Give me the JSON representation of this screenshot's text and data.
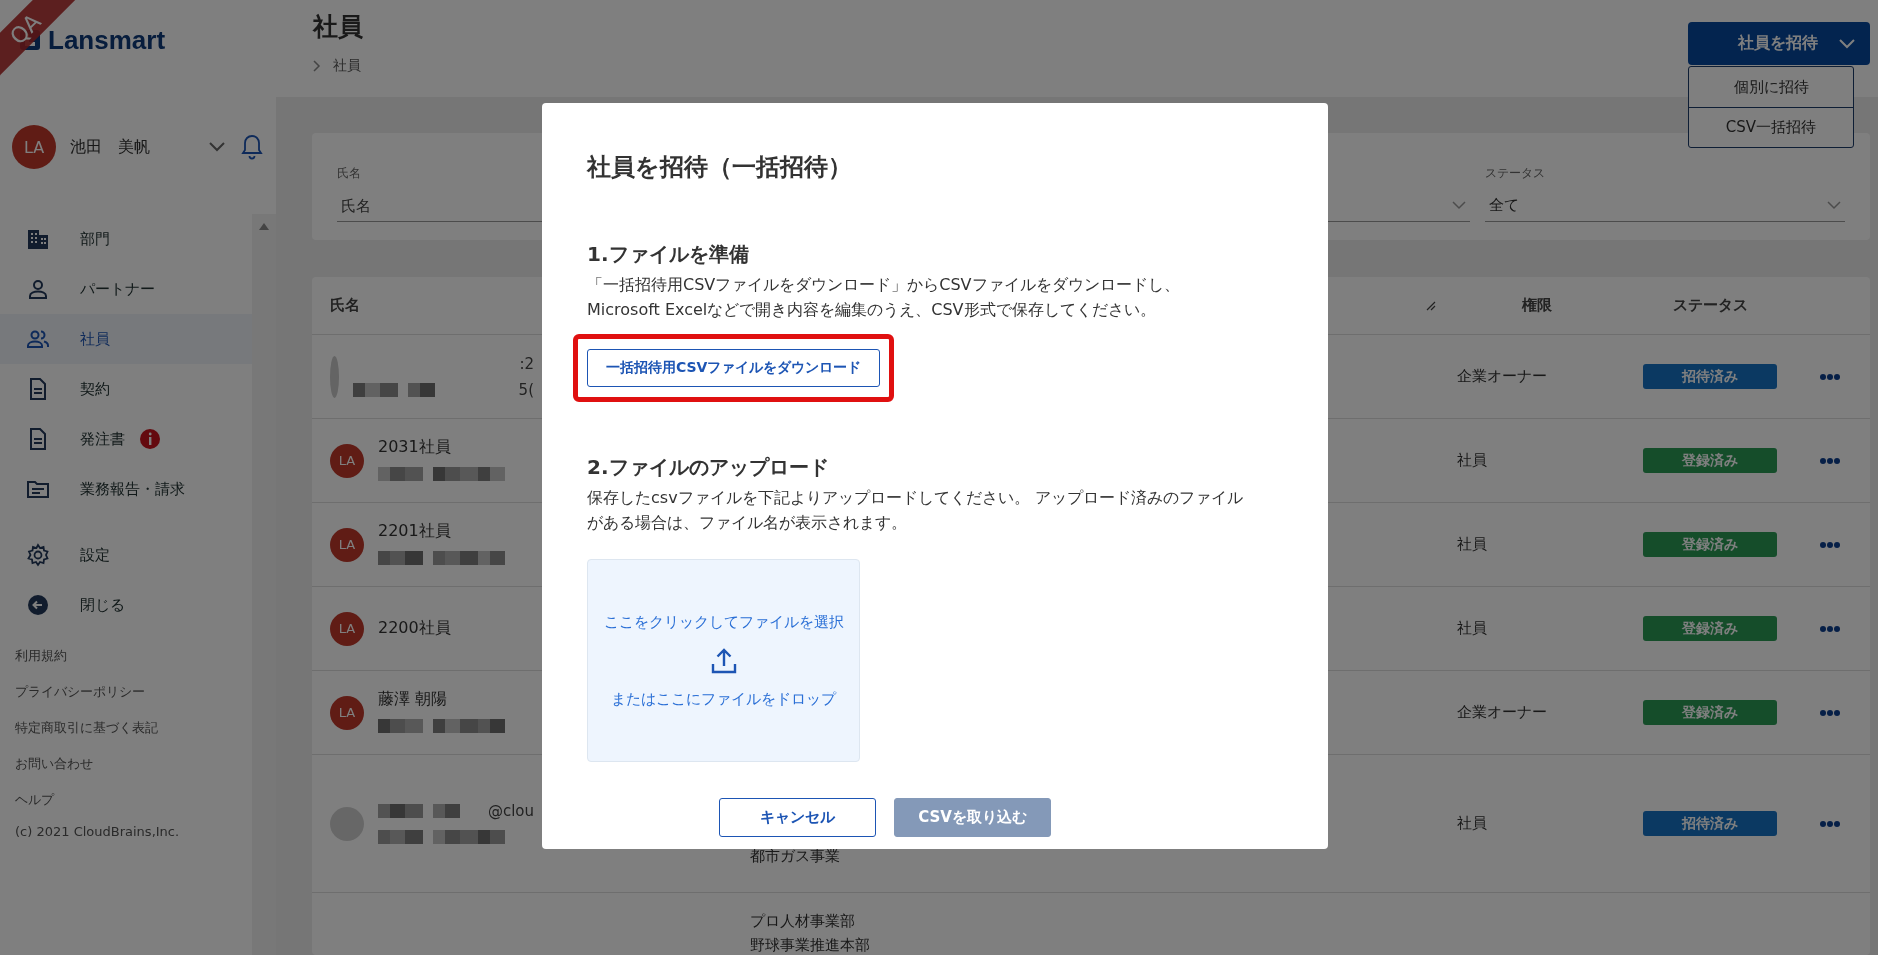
{
  "app": {
    "logo": "Lansmart",
    "ribbon": "QA"
  },
  "user": {
    "initials": "LA",
    "name": "池田　美帆"
  },
  "nav": [
    {
      "label": "部門",
      "selected": false,
      "alert": false
    },
    {
      "label": "パートナー",
      "selected": false,
      "alert": false
    },
    {
      "label": "社員",
      "selected": true,
      "alert": false
    },
    {
      "label": "契約",
      "selected": false,
      "alert": false
    },
    {
      "label": "発注書",
      "selected": false,
      "alert": true
    },
    {
      "label": "業務報告・請求",
      "selected": false,
      "alert": false
    }
  ],
  "nav_bottom": [
    {
      "label": "設定"
    },
    {
      "label": "閉じる"
    }
  ],
  "footer_links": [
    "利用規約",
    "プライバシーポリシー",
    "特定商取引に基づく表記",
    "お問い合わせ",
    "ヘルプ"
  ],
  "copyright": "(c) 2021 CloudBrains,Inc.",
  "page": {
    "title": "社員",
    "breadcrumb": "社員"
  },
  "invite_button": {
    "label": "社員を招待",
    "expanded": true,
    "menu": [
      "個別に招待",
      "CSV一括招待"
    ]
  },
  "filters": [
    {
      "kind": "text",
      "label": "氏名",
      "placeholder": "氏名"
    },
    {
      "kind": "select"
    },
    {
      "kind": "select",
      "label": "ステータス",
      "value": "全て"
    }
  ],
  "table": {
    "columns": [
      {
        "label": "氏名"
      },
      {
        "label": "権限"
      },
      {
        "label": "ステータス"
      }
    ],
    "rows": [
      {
        "avatar": {
          "kind": "sliver"
        },
        "name_line": {
          "redacted": false,
          "tail": ":2"
        },
        "detail_line": {
          "redacted": true,
          "tail": "5("
        },
        "role": "企業オーナー",
        "status": {
          "label": "招待済み",
          "kind": "invited"
        }
      },
      {
        "avatar": {
          "kind": "initials",
          "initials": "LA"
        },
        "name_line": {
          "text": "2031社員",
          "redacted": false
        },
        "detail_line": {
          "redacted": true
        },
        "role": "社員",
        "status": {
          "label": "登録済み",
          "kind": "registered"
        }
      },
      {
        "avatar": {
          "kind": "initials",
          "initials": "LA"
        },
        "name_line": {
          "text": "2201社員",
          "redacted": false
        },
        "detail_line": {
          "redacted": true
        },
        "role": "社員",
        "status": {
          "label": "登録済み",
          "kind": "registered"
        }
      },
      {
        "avatar": {
          "kind": "initials",
          "initials": "LA"
        },
        "name_line": {
          "text": "2200社員",
          "redacted": false
        },
        "role": "社員",
        "status": {
          "label": "登録済み",
          "kind": "registered"
        }
      },
      {
        "avatar": {
          "kind": "initials",
          "initials": "LA"
        },
        "name_line": {
          "text": "藤澤 朝陽",
          "redacted": false
        },
        "detail_line": {
          "redacted": true
        },
        "role": "企業オーナー",
        "status": {
          "label": "登録済み",
          "kind": "registered"
        }
      },
      {
        "avatar": {
          "kind": "blank"
        },
        "name_line": {
          "redacted": true,
          "tail": "@clou"
        },
        "detail_line": {
          "redacted": true
        },
        "department": [
          "都市ガス事業"
        ],
        "role": "社員",
        "status": {
          "label": "招待済み",
          "kind": "invited"
        }
      },
      {
        "department": [
          "プロ人材事業部",
          "野球事業推進本部"
        ]
      }
    ]
  },
  "modal": {
    "title": "社員を招待（一括招待）",
    "sections": [
      {
        "kind": "download",
        "heading": "1.ファイルを準備",
        "text": "「一括招待用CSVファイルをダウンロード」からCSVファイルをダウンロードし、Microsoft Excelなどで開き内容を編集のうえ、CSV形式で保存してください。",
        "button": {
          "label": "一括招待用CSVファイルをダウンロード",
          "highlighted": true
        }
      },
      {
        "kind": "upload",
        "heading": "2.ファイルのアップロード",
        "text": "保存したcsvファイルを下記よりアップロードしてください。 アップロード済みのファイルがある場合は、ファイル名が表示されます。",
        "dropzone": {
          "select_text": "ここをクリックしてファイルを選択",
          "drop_text": "またはここにファイルをドロップ"
        }
      }
    ],
    "actions": [
      {
        "label": "キャンセル",
        "kind": "secondary",
        "disabled": false
      },
      {
        "label": "CSVを取り込む",
        "kind": "primary",
        "disabled": true
      }
    ]
  }
}
